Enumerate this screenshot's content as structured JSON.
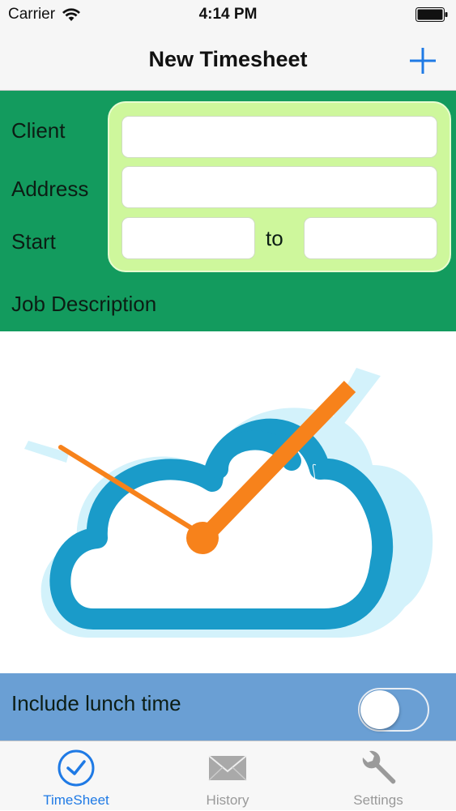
{
  "status_bar": {
    "carrier": "Carrier",
    "time": "4:14 PM"
  },
  "nav": {
    "title": "New Timesheet",
    "add_icon": "plus-icon"
  },
  "form": {
    "client_label": "Client",
    "address_label": "Address",
    "start_label": "Start",
    "to_label": "to",
    "job_description_label": "Job Description",
    "client_value": "",
    "address_value": "",
    "start_value": "",
    "end_value": ""
  },
  "lunch": {
    "label": "Include lunch time",
    "on": false
  },
  "tabs": [
    {
      "label": "TimeSheet",
      "icon": "clock-check-icon",
      "active": true
    },
    {
      "label": "History",
      "icon": "envelope-icon",
      "active": false
    },
    {
      "label": "Settings",
      "icon": "wrench-icon",
      "active": false
    }
  ],
  "colors": {
    "form_bg": "#139b5e",
    "field_panel": "#cef79c",
    "lunch_bg": "#6a9fd4",
    "accent": "#1f7ae5",
    "logo_blue": "#1a9bc9",
    "logo_light": "#d3f2fb",
    "logo_orange": "#f7821b"
  }
}
